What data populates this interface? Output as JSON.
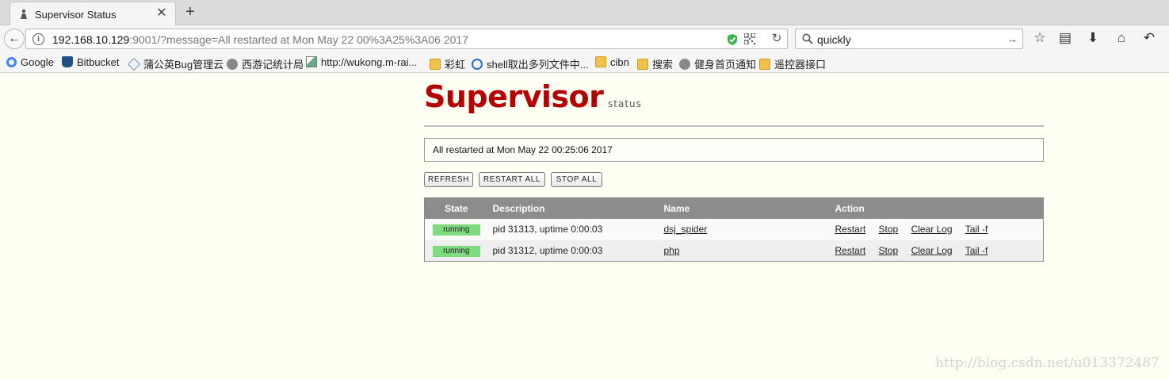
{
  "browser": {
    "tab_title": "Supervisor Status",
    "close_glyph": "✕",
    "new_tab_glyph": "+",
    "url_host": "192.168.10.129",
    "url_rest": ":9001/?message=All restarted at Mon May 22 00%3A25%3A06 2017",
    "search_value": "quickly",
    "icons": [
      "back-arrow-icon",
      "info-icon",
      "shield-icon",
      "qr-code-icon",
      "reload-icon",
      "search-icon",
      "star-icon",
      "reader-icon",
      "download-icon",
      "home-icon",
      "undo-icon"
    ],
    "bookmarks": [
      {
        "label": "Google",
        "icon": "google-icon"
      },
      {
        "label": "Bitbucket",
        "icon": "bitbucket-icon"
      },
      {
        "label": "蒲公英Bug管理云",
        "icon": "cube-icon"
      },
      {
        "label": "西游记统计局",
        "icon": "globe-icon"
      },
      {
        "label": "http://wukong.m-rai...",
        "icon": "image-icon"
      },
      {
        "label": "彩虹",
        "icon": "folder-icon"
      },
      {
        "label": "shell取出多列文件中...",
        "icon": "globe-icon"
      },
      {
        "label": "cibn",
        "icon": "folder-icon"
      },
      {
        "label": "搜索",
        "icon": "folder-icon"
      },
      {
        "label": "健身首页通知",
        "icon": "globe-icon"
      },
      {
        "label": "遥控器接口",
        "icon": "folder-icon"
      }
    ]
  },
  "page": {
    "logo_main": "Supervisor",
    "logo_sub": "status",
    "message": "All restarted at Mon May 22 00:25:06 2017",
    "buttons": {
      "refresh": "REFRESH",
      "restart_all": "RESTART ALL",
      "stop_all": "STOP ALL"
    },
    "table": {
      "headers": {
        "state": "State",
        "description": "Description",
        "name": "Name",
        "action": "Action"
      },
      "rows": [
        {
          "state": "running",
          "description": "pid 31313, uptime 0:00:03",
          "name": "dsj_spider",
          "actions": [
            "Restart",
            "Stop",
            "Clear Log",
            "Tail -f"
          ]
        },
        {
          "state": "running",
          "description": "pid 31312, uptime 0:00:03",
          "name": "php",
          "actions": [
            "Restart",
            "Stop",
            "Clear Log",
            "Tail -f"
          ]
        }
      ]
    },
    "watermark": "http://blog.csdn.net/u013372487",
    "colors": {
      "logo": "#b50000",
      "running": "#7ddb7d",
      "header": "#8c8c8c",
      "background": "#fffff3"
    }
  }
}
